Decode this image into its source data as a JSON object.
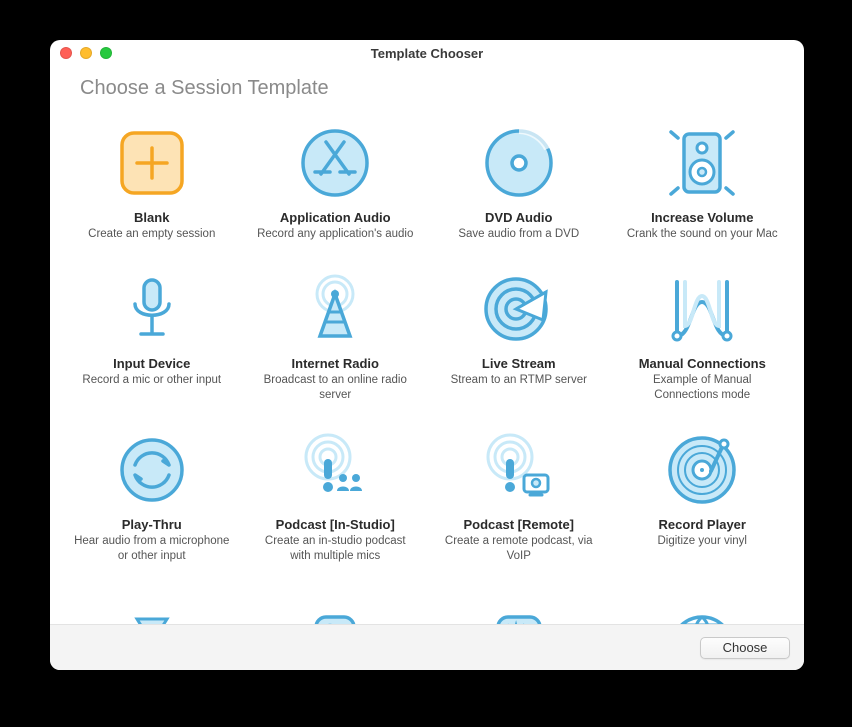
{
  "window": {
    "title": "Template Chooser",
    "header": "Choose a Session Template",
    "choose_label": "Choose"
  },
  "templates": [
    {
      "icon": "plus",
      "title": "Blank",
      "desc": "Create an empty session"
    },
    {
      "icon": "app-store",
      "title": "Application Audio",
      "desc": "Record any application's audio"
    },
    {
      "icon": "disc",
      "title": "DVD Audio",
      "desc": "Save audio from a DVD"
    },
    {
      "icon": "speaker",
      "title": "Increase Volume",
      "desc": "Crank the sound on your Mac"
    },
    {
      "icon": "mic",
      "title": "Input Device",
      "desc": "Record a mic or other input"
    },
    {
      "icon": "radio-tower",
      "title": "Internet Radio",
      "desc": "Broadcast to an online radio server"
    },
    {
      "icon": "broadcast",
      "title": "Live Stream",
      "desc": "Stream to an RTMP server"
    },
    {
      "icon": "manual",
      "title": "Manual Connections",
      "desc": "Example of Manual Connections mode"
    },
    {
      "icon": "loop",
      "title": "Play-Thru",
      "desc": "Hear audio from a microphone or other input"
    },
    {
      "icon": "podcast-studio",
      "title": "Podcast [In-Studio]",
      "desc": "Create an in-studio podcast with multiple mics"
    },
    {
      "icon": "podcast-remote",
      "title": "Podcast [Remote]",
      "desc": "Create a remote podcast, via VoIP"
    },
    {
      "icon": "vinyl",
      "title": "Record Player",
      "desc": "Digitize your vinyl"
    },
    {
      "icon": "partial-1",
      "title": "",
      "desc": ""
    },
    {
      "icon": "partial-2",
      "title": "",
      "desc": ""
    },
    {
      "icon": "partial-3",
      "title": "",
      "desc": ""
    },
    {
      "icon": "partial-4",
      "title": "",
      "desc": ""
    }
  ],
  "colors": {
    "accent_orange_stroke": "#f5a623",
    "accent_orange_fill": "#fde3b5",
    "accent_blue_stroke": "#4aa8d8",
    "accent_blue_fill": "#c8e9f8"
  }
}
